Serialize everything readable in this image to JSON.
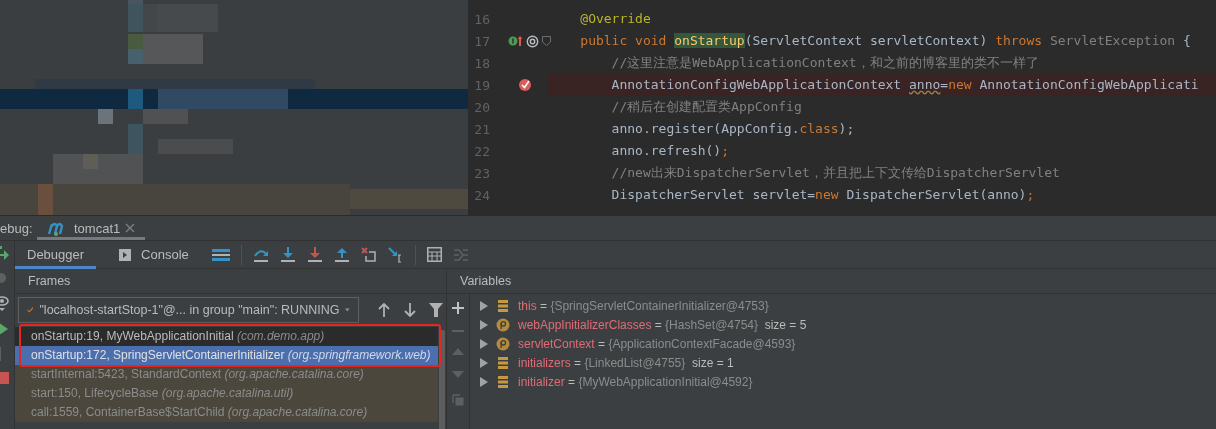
{
  "editor": {
    "lines": [
      {
        "number": "16",
        "override": false,
        "breakpoint": false,
        "current": false,
        "tokens": [
          {
            "kind": "annotation",
            "text": "    @Override"
          }
        ]
      },
      {
        "number": "17",
        "override": true,
        "breakpoint": false,
        "current": false,
        "tokens": [
          {
            "kind": "keyword",
            "text": "    public void "
          },
          {
            "kind": "declaration",
            "text": "onStartup"
          },
          {
            "kind": "plain",
            "text": "(ServletContext servletContext) "
          },
          {
            "kind": "keyword",
            "text": "throws "
          },
          {
            "kind": "dim",
            "text": "ServletException "
          },
          {
            "kind": "plain",
            "text": "{"
          }
        ]
      },
      {
        "number": "18",
        "override": false,
        "breakpoint": false,
        "current": false,
        "tokens": [
          {
            "kind": "comment",
            "text": "        //这里注意是WebApplicationContext，和之前的博客里的类不一样了"
          }
        ]
      },
      {
        "number": "19",
        "override": false,
        "breakpoint": true,
        "current": true,
        "tokens": [
          {
            "kind": "plain",
            "text": "        AnnotationConfigWebApplicationContext "
          },
          {
            "kind": "warning",
            "text": "anno"
          },
          {
            "kind": "plain",
            "text": "="
          },
          {
            "kind": "keyword",
            "text": "new "
          },
          {
            "kind": "plain",
            "text": "AnnotationConfigWebApplicati"
          }
        ]
      },
      {
        "number": "20",
        "override": false,
        "breakpoint": false,
        "current": false,
        "tokens": [
          {
            "kind": "comment",
            "text": "        //稍后在创建配置类AppConfig"
          }
        ]
      },
      {
        "number": "21",
        "override": false,
        "breakpoint": false,
        "current": false,
        "tokens": [
          {
            "kind": "plain",
            "text": "        anno.register(AppConfig."
          },
          {
            "kind": "keyword",
            "text": "class"
          },
          {
            "kind": "plain",
            "text": ");"
          }
        ]
      },
      {
        "number": "22",
        "override": false,
        "breakpoint": false,
        "current": false,
        "tokens": [
          {
            "kind": "plain",
            "text": "        anno.refresh()"
          },
          {
            "kind": "keyword",
            "text": ";"
          }
        ]
      },
      {
        "number": "23",
        "override": false,
        "breakpoint": false,
        "current": false,
        "tokens": [
          {
            "kind": "comment",
            "text": "        //new出来DispatcherServlet，并且把上下文传给DispatcherServlet"
          }
        ]
      },
      {
        "number": "24",
        "override": false,
        "breakpoint": false,
        "current": false,
        "tokens": [
          {
            "kind": "plain",
            "text": "        DispatcherServlet servlet="
          },
          {
            "kind": "keyword",
            "text": "new "
          },
          {
            "kind": "plain",
            "text": "DispatcherServlet(anno)"
          },
          {
            "kind": "keyword",
            "text": ";"
          }
        ]
      }
    ]
  },
  "debug": {
    "label": "ebug:",
    "session_tab": {
      "label": "tomcat1",
      "selected": true
    },
    "tabs": [
      {
        "label": "Debugger",
        "selected": true
      },
      {
        "label": "Console",
        "selected": false
      }
    ]
  },
  "frames": {
    "title": "Frames",
    "thread": "\"localhost-startStop-1\"@... in group \"main\": RUNNING",
    "items": [
      {
        "method": "onStartup:19, MyWebApplicationInitial",
        "package": "(com.demo.app)",
        "selected": false,
        "library": false
      },
      {
        "method": "onStartup:172, SpringServletContainerInitializer",
        "package": "(org.springframework.web)",
        "selected": true,
        "library": false
      },
      {
        "method": "startInternal:5423, StandardContext",
        "package": "(org.apache.catalina.core)",
        "selected": false,
        "library": true
      },
      {
        "method": "start:150, LifecycleBase",
        "package": "(org.apache.catalina.util)",
        "selected": false,
        "library": true
      },
      {
        "method": "call:1559, ContainerBase$StartChild",
        "package": "(org.apache.catalina.core)",
        "selected": false,
        "library": true
      }
    ]
  },
  "variables": {
    "title": "Variables",
    "items": [
      {
        "kind": "field",
        "name": "this",
        "operator": "=",
        "value": "{SpringServletContainerInitializer@4753}"
      },
      {
        "kind": "parameter",
        "name": "webAppInitializerClasses",
        "operator": "=",
        "value": "{HashSet@4754}",
        "size": "size = 5"
      },
      {
        "kind": "parameter",
        "name": "servletContext",
        "operator": "=",
        "value": "{ApplicationContextFacade@4593}"
      },
      {
        "kind": "field",
        "name": "initializers",
        "operator": "=",
        "value": "{LinkedList@4755}",
        "size": "size = 1"
      },
      {
        "kind": "field",
        "name": "initializer",
        "operator": "=",
        "value": "{MyWebApplicationInitial@4592}"
      }
    ]
  }
}
